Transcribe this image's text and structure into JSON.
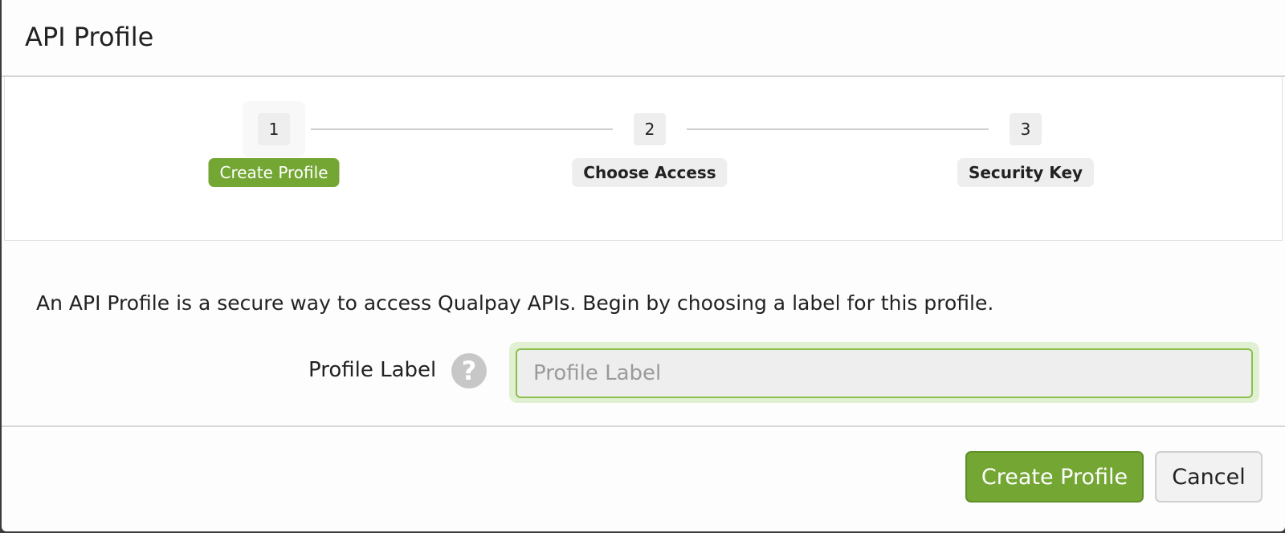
{
  "modal": {
    "title": "API Profile"
  },
  "steps": [
    {
      "number": "1",
      "label": "Create Profile",
      "active": true
    },
    {
      "number": "2",
      "label": "Choose Access",
      "active": false
    },
    {
      "number": "3",
      "label": "Security Key",
      "active": false
    }
  ],
  "form": {
    "intro": "An API Profile is a secure way to access Qualpay APIs. Begin by choosing a label for this profile.",
    "profile_label": {
      "label": "Profile Label",
      "placeholder": "Profile Label",
      "value": "",
      "help_icon": "question-circle-icon"
    }
  },
  "footer": {
    "create_label": "Create Profile",
    "cancel_label": "Cancel"
  },
  "colors": {
    "accent": "#74a634",
    "input_focus_border": "#8ac04a",
    "input_focus_glow": "#e1efd2"
  }
}
